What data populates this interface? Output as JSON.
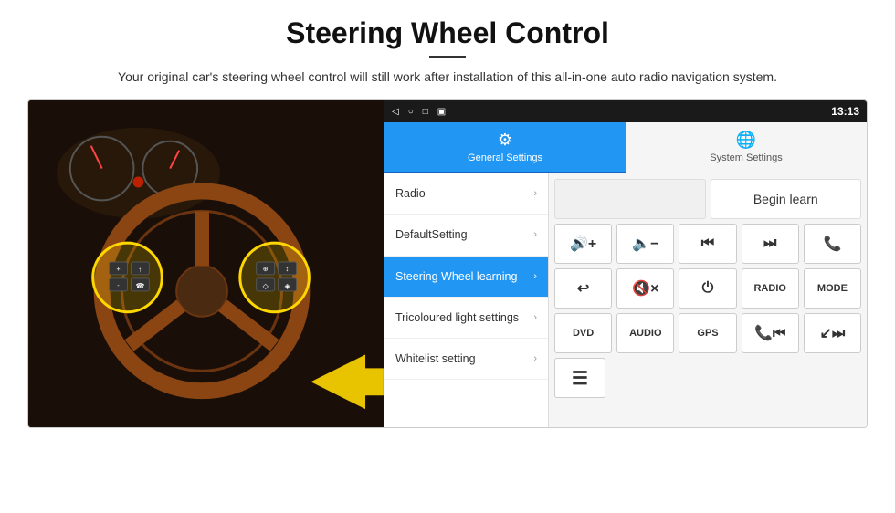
{
  "header": {
    "title": "Steering Wheel Control",
    "subtitle": "Your original car's steering wheel control will still work after installation of this all-in-one auto radio navigation system."
  },
  "status_bar": {
    "icons": [
      "◁",
      "○",
      "□",
      "▣"
    ],
    "signal": "♦ ▼",
    "time": "13:13"
  },
  "nav_tabs": [
    {
      "id": "general",
      "label": "General Settings",
      "icon": "⚙",
      "active": true
    },
    {
      "id": "system",
      "label": "System Settings",
      "icon": "🌐",
      "active": false
    }
  ],
  "menu_items": [
    {
      "id": "radio",
      "label": "Radio",
      "active": false
    },
    {
      "id": "default",
      "label": "DefaultSetting",
      "active": false
    },
    {
      "id": "steering",
      "label": "Steering Wheel learning",
      "active": true
    },
    {
      "id": "tricoloured",
      "label": "Tricoloured light settings",
      "active": false
    },
    {
      "id": "whitelist",
      "label": "Whitelist setting",
      "active": false
    }
  ],
  "controls": {
    "begin_learn": "Begin learn",
    "rows": [
      [
        {
          "id": "vol-up",
          "label": "🔊+",
          "type": "icon"
        },
        {
          "id": "vol-down",
          "label": "🔈-",
          "type": "icon"
        },
        {
          "id": "prev-track",
          "label": "⏮",
          "type": "icon"
        },
        {
          "id": "next-track",
          "label": "⏭",
          "type": "icon"
        },
        {
          "id": "phone",
          "label": "📞",
          "type": "icon"
        }
      ],
      [
        {
          "id": "hang-up",
          "label": "↩",
          "type": "icon"
        },
        {
          "id": "mute",
          "label": "🔇×",
          "type": "icon"
        },
        {
          "id": "power",
          "label": "⏻",
          "type": "icon"
        },
        {
          "id": "radio-btn",
          "label": "RADIO",
          "type": "text"
        },
        {
          "id": "mode-btn",
          "label": "MODE",
          "type": "text"
        }
      ],
      [
        {
          "id": "dvd-btn",
          "label": "DVD",
          "type": "text"
        },
        {
          "id": "audio-btn",
          "label": "AUDIO",
          "type": "text"
        },
        {
          "id": "gps-btn",
          "label": "GPS",
          "type": "text"
        },
        {
          "id": "nav-prev",
          "label": "📞⏮",
          "type": "icon"
        },
        {
          "id": "nav-next",
          "label": "↙⏭",
          "type": "icon"
        }
      ],
      [
        {
          "id": "scan-btn",
          "label": "☰",
          "type": "icon"
        }
      ]
    ]
  }
}
